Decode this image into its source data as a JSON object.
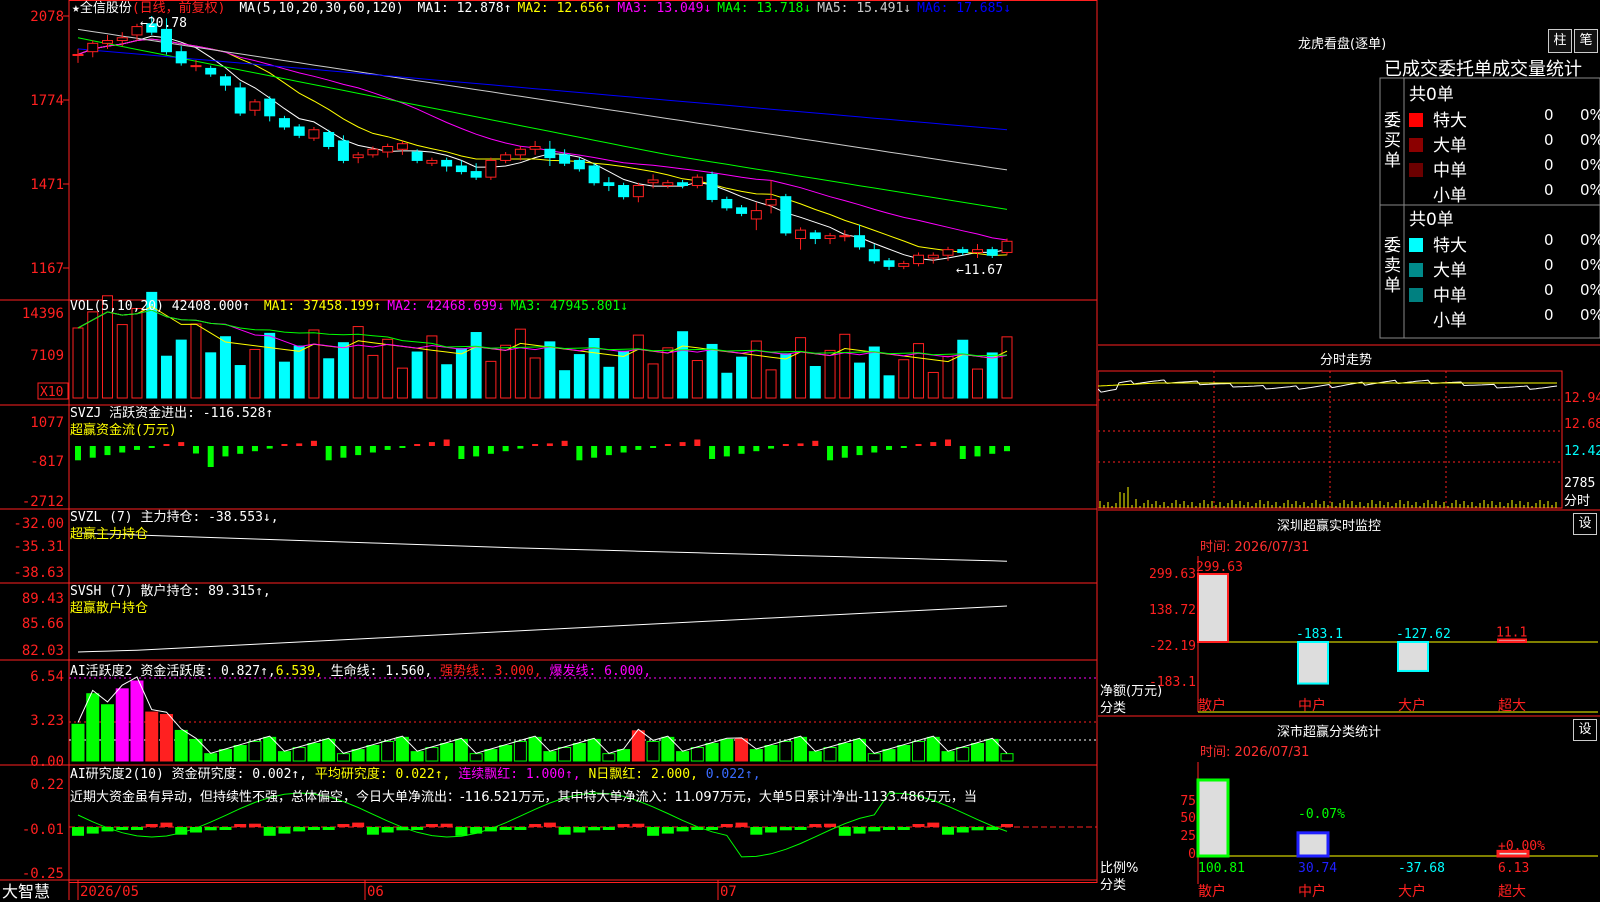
{
  "app": {
    "brand": "大智慧"
  },
  "main_chart": {
    "title": "★全信股份",
    "period": "(日线，前复权)",
    "ma_label": "MA(5,10,20,30,60,120)",
    "ma_values": [
      {
        "text": "MA1: 12.878↑",
        "color": "#ffffff"
      },
      {
        "text": "MA2: 12.656↑",
        "color": "#ffff00"
      },
      {
        "text": "MA3: 13.049↓",
        "color": "#ff00ff"
      },
      {
        "text": "MA4: 13.718↓",
        "color": "#00ff00"
      },
      {
        "text": "MA5: 15.491↓",
        "color": "#cccccc"
      },
      {
        "text": "MA6: 17.685↓",
        "color": "#0000ff"
      }
    ],
    "y_ticks": [
      "2078",
      "1774",
      "1471",
      "1167"
    ],
    "high_label": "20.78",
    "low_label": "11.67",
    "date_ticks": [
      "2026/05",
      "06",
      "07"
    ],
    "candles": [
      [
        19.4,
        19.6,
        19.1,
        19.4
      ],
      [
        19.5,
        19.9,
        19.3,
        19.8
      ],
      [
        19.8,
        20.1,
        19.6,
        19.9
      ],
      [
        19.9,
        20.2,
        19.7,
        20.0
      ],
      [
        20.1,
        20.5,
        19.9,
        20.4
      ],
      [
        20.5,
        20.78,
        20.1,
        20.2
      ],
      [
        20.3,
        20.7,
        19.4,
        19.5
      ],
      [
        19.5,
        19.7,
        19.0,
        19.1
      ],
      [
        19.0,
        19.2,
        18.8,
        19.0
      ],
      [
        18.9,
        19.0,
        18.6,
        18.7
      ],
      [
        18.6,
        18.7,
        18.1,
        18.3
      ],
      [
        18.2,
        18.4,
        17.2,
        17.3
      ],
      [
        17.4,
        17.8,
        17.2,
        17.7
      ],
      [
        17.8,
        17.9,
        17.0,
        17.2
      ],
      [
        17.1,
        17.2,
        16.7,
        16.8
      ],
      [
        16.8,
        16.9,
        16.4,
        16.5
      ],
      [
        16.4,
        16.8,
        16.3,
        16.7
      ],
      [
        16.6,
        16.7,
        16.0,
        16.1
      ],
      [
        16.3,
        16.5,
        15.5,
        15.6
      ],
      [
        15.7,
        15.9,
        15.5,
        15.8
      ],
      [
        15.8,
        16.1,
        15.7,
        16.0
      ],
      [
        15.9,
        16.2,
        15.7,
        16.1
      ],
      [
        16.0,
        16.3,
        15.8,
        16.2
      ],
      [
        15.9,
        16.0,
        15.5,
        15.6
      ],
      [
        15.5,
        15.7,
        15.4,
        15.6
      ],
      [
        15.6,
        15.7,
        15.2,
        15.4
      ],
      [
        15.4,
        15.6,
        15.1,
        15.2
      ],
      [
        15.2,
        15.5,
        14.9,
        15.0
      ],
      [
        15.0,
        15.7,
        14.9,
        15.6
      ],
      [
        15.6,
        15.9,
        15.5,
        15.8
      ],
      [
        15.8,
        16.1,
        15.6,
        16.0
      ],
      [
        16.0,
        16.3,
        15.8,
        16.1
      ],
      [
        16.0,
        16.3,
        15.4,
        15.7
      ],
      [
        15.8,
        16.0,
        15.4,
        15.5
      ],
      [
        15.6,
        15.7,
        15.2,
        15.3
      ],
      [
        15.4,
        15.5,
        14.7,
        14.8
      ],
      [
        14.8,
        15.0,
        14.5,
        14.7
      ],
      [
        14.7,
        14.8,
        14.2,
        14.3
      ],
      [
        14.3,
        14.8,
        14.1,
        14.7
      ],
      [
        14.8,
        15.1,
        14.6,
        14.9
      ],
      [
        14.7,
        14.9,
        14.6,
        14.8
      ],
      [
        14.8,
        14.9,
        14.6,
        14.7
      ],
      [
        14.7,
        15.1,
        14.6,
        15.0
      ],
      [
        15.1,
        15.2,
        14.1,
        14.2
      ],
      [
        14.2,
        14.3,
        13.8,
        13.9
      ],
      [
        13.9,
        14.0,
        13.6,
        13.7
      ],
      [
        13.5,
        14.1,
        13.1,
        13.8
      ],
      [
        14.0,
        14.9,
        13.7,
        14.2
      ],
      [
        14.3,
        14.4,
        12.9,
        13.0
      ],
      [
        12.8,
        13.2,
        12.4,
        13.1
      ],
      [
        13.0,
        13.1,
        12.6,
        12.8
      ],
      [
        12.8,
        13.0,
        12.6,
        12.9
      ],
      [
        12.9,
        13.1,
        12.7,
        12.9
      ],
      [
        12.9,
        13.3,
        12.4,
        12.5
      ],
      [
        12.4,
        12.6,
        11.9,
        12.0
      ],
      [
        12.0,
        12.1,
        11.67,
        11.8
      ],
      [
        11.8,
        12.0,
        11.7,
        11.9
      ],
      [
        11.9,
        12.3,
        11.8,
        12.2
      ],
      [
        12.1,
        12.3,
        11.9,
        12.2
      ],
      [
        12.2,
        12.5,
        12.0,
        12.4
      ],
      [
        12.4,
        12.5,
        12.2,
        12.3
      ],
      [
        12.3,
        12.6,
        12.1,
        12.4
      ],
      [
        12.4,
        12.5,
        12.1,
        12.2
      ],
      [
        12.3,
        12.8,
        12.2,
        12.7
      ]
    ]
  },
  "vol_panel": {
    "label": "VOL(5,10,20)",
    "value": "42408.000↑",
    "ma": [
      {
        "text": "MA1: 37458.199↑",
        "color": "#ffff00"
      },
      {
        "text": "MA2: 42468.699↓",
        "color": "#ff00ff"
      },
      {
        "text": "MA3: 47945.801↓",
        "color": "#00ff00"
      }
    ],
    "y_ticks": [
      "14396",
      "7109"
    ],
    "unit": "X10"
  },
  "svzj": {
    "label": "SVZJ",
    "text": "活跃资金进出: -116.528↑",
    "sub": "超赢资金流(万元)",
    "y_ticks": [
      "1077",
      "-817",
      "-2712"
    ]
  },
  "svzl": {
    "label": "SVZL (7)",
    "text": "主力持仓: -38.553↓,",
    "sub": "超赢主力持仓",
    "y_ticks": [
      "-32.00",
      "-35.31",
      "-38.63"
    ]
  },
  "svsh": {
    "label": "SVSH (7)",
    "text": "散户持仓: 89.315↑,",
    "sub": "超赢散户持仓",
    "y_ticks": [
      "89.43",
      "85.66",
      "82.03"
    ]
  },
  "ai_act": {
    "label": "AI活跃度2",
    "text": "资金活跃度: 0.827↑,",
    "v2": "6.539,",
    "life": "生命线: 1.560,",
    "strong": "强势线: 3.000,",
    "burst": "爆发线: 6.000,",
    "y_ticks": [
      "6.54",
      "3.23",
      "0.00"
    ]
  },
  "ai_res": {
    "label": "AI研究度2(10)",
    "text": "资金研究度: 0.002↑,",
    "avg": "平均研究度: 0.022↑,",
    "red": "连续飘红: 1.000↑,",
    "nday": "N日飘红: 2.000,",
    "last": "0.022↑,",
    "desc": "近期大资金虽有异动，但持续性不强，总体偏空，今日大单净流出：-116.521万元，其中特大单净流入：11.097万元，大单5日累计净出-1133.486万元，当",
    "y_ticks": [
      "0.22",
      "-0.01",
      "-0.25"
    ]
  },
  "right": {
    "lhb_title": "龙虎看盘(逐单)",
    "btn_bar": "柱",
    "btn_pen": "笔",
    "stats_title": "已成交委托单成交量统计",
    "buy_label": "委买单",
    "sell_label": "委卖单",
    "total_label": "共0单",
    "rows": [
      {
        "name": "特大",
        "n": "0",
        "pct": "0%"
      },
      {
        "name": "大单",
        "n": "0",
        "pct": "0%"
      },
      {
        "name": "中单",
        "n": "0",
        "pct": "0%"
      },
      {
        "name": "小单",
        "n": "0",
        "pct": "0%"
      }
    ],
    "buy_colors": [
      "#ff0000",
      "#8b0000",
      "#6b0000",
      "#000000"
    ],
    "sell_colors": [
      "#00ffff",
      "#008b8b",
      "#008080",
      "#000000"
    ],
    "fenshi_title": "分时走势",
    "fenshi_ticks": [
      "12.94",
      "12.68",
      "12.42"
    ],
    "fenshi_vol": "2785",
    "fenshi_unit": "分时",
    "monitor_title": "深圳超赢实时监控",
    "monitor_btn": "设",
    "monitor_time": "时间: 2026/07/31",
    "monitor_ticks": [
      "299.63",
      "138.72",
      "-22.19",
      "-183.1"
    ],
    "monitor_axis": "净额(万元)",
    "monitor_cat_label": "分类",
    "monitor_bars": [
      {
        "cat": "散户",
        "value": 299.63,
        "label": "299.63"
      },
      {
        "cat": "中户",
        "value": -183.1,
        "label": "-183.1"
      },
      {
        "cat": "大户",
        "value": -127.62,
        "label": "-127.62"
      },
      {
        "cat": "超大",
        "value": 11.1,
        "label": "11.1"
      }
    ],
    "class_title": "深市超赢分类统计",
    "class_btn": "设",
    "class_time": "时间: 2026/07/31",
    "class_ticks": [
      "75",
      "50",
      "25",
      "0"
    ],
    "class_axis": "比例%",
    "class_cat_label": "分类",
    "class_bars": [
      {
        "cat": "散户",
        "value": 100.81,
        "label": "100.81",
        "top": ""
      },
      {
        "cat": "中户",
        "value": 30.74,
        "label": "30.74",
        "top": "-0.07%"
      },
      {
        "cat": "大户",
        "value": -37.68,
        "label": "-37.68",
        "top": ""
      },
      {
        "cat": "超大",
        "value": 6.13,
        "label": "6.13",
        "top": "+0.00%"
      }
    ]
  }
}
